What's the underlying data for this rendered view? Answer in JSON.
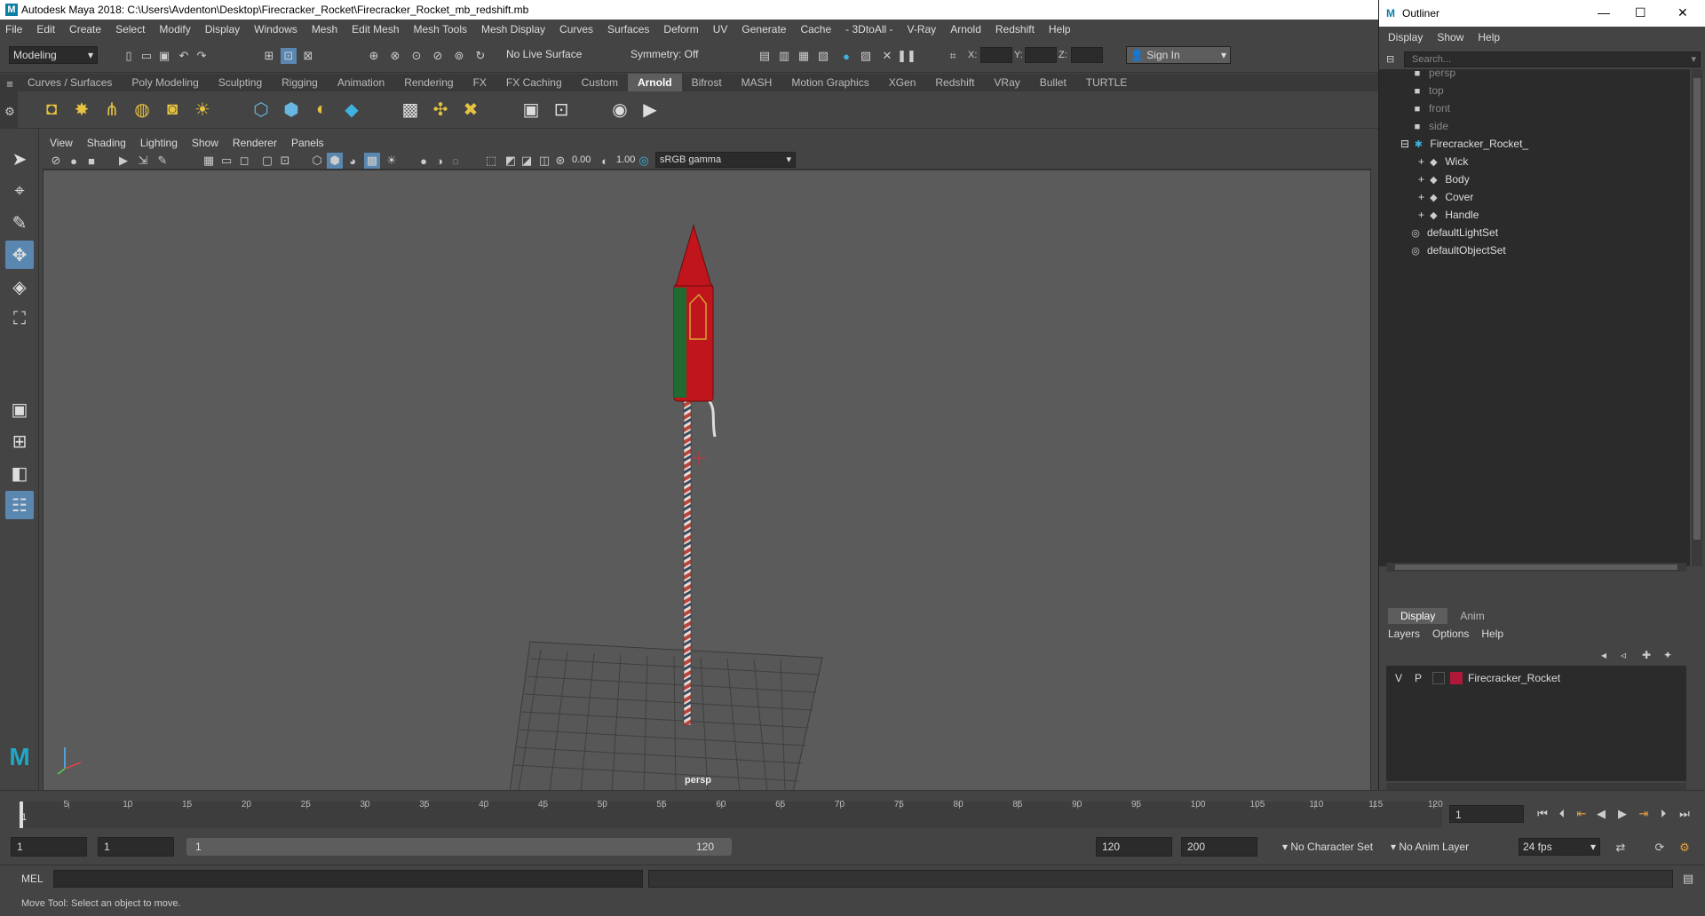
{
  "window": {
    "title": "Autodesk Maya 2018: C:\\Users\\Avdenton\\Desktop\\Firecracker_Rocket\\Firecracker_Rocket_mb_redshift.mb"
  },
  "menubar": [
    "File",
    "Edit",
    "Create",
    "Select",
    "Modify",
    "Display",
    "Windows",
    "Mesh",
    "Edit Mesh",
    "Mesh Tools",
    "Mesh Display",
    "Curves",
    "Surfaces",
    "Deform",
    "UV",
    "Generate",
    "Cache",
    "- 3DtoAll -",
    "V-Ray",
    "Arnold",
    "Redshift",
    "Help"
  ],
  "statusline": {
    "mode": "Modeling",
    "live_surface": "No Live Surface",
    "symmetry": "Symmetry: Off",
    "x_label": "X:",
    "y_label": "Y:",
    "z_label": "Z:",
    "sign_in": "Sign In"
  },
  "shelf_tabs": [
    "Curves / Surfaces",
    "Poly Modeling",
    "Sculpting",
    "Rigging",
    "Animation",
    "Rendering",
    "FX",
    "FX Caching",
    "Custom",
    "Arnold",
    "Bifrost",
    "MASH",
    "Motion Graphics",
    "XGen",
    "Redshift",
    "VRay",
    "Bullet",
    "TURTLE"
  ],
  "shelf_active": "Arnold",
  "viewport": {
    "menu": [
      "View",
      "Shading",
      "Lighting",
      "Show",
      "Renderer",
      "Panels"
    ],
    "exposure": "0.00",
    "gamma": "1.00",
    "color_space": "sRGB gamma",
    "camera_label": "persp"
  },
  "outliner": {
    "title": "Outliner",
    "menu": [
      "Display",
      "Show",
      "Help"
    ],
    "search_placeholder": "Search...",
    "items": [
      {
        "label": "persp",
        "dim": true,
        "icon": "camera-icon"
      },
      {
        "label": "top",
        "dim": true,
        "icon": "camera-icon"
      },
      {
        "label": "front",
        "dim": true,
        "icon": "camera-icon"
      },
      {
        "label": "side",
        "dim": true,
        "icon": "camera-icon"
      },
      {
        "label": "Firecracker_Rocket_",
        "dim": false,
        "icon": "group-icon"
      },
      {
        "label": "Wick",
        "dim": false,
        "icon": "mesh-icon"
      },
      {
        "label": "Body",
        "dim": false,
        "icon": "mesh-icon"
      },
      {
        "label": "Cover",
        "dim": false,
        "icon": "mesh-icon"
      },
      {
        "label": "Handle",
        "dim": false,
        "icon": "mesh-icon"
      },
      {
        "label": "defaultLightSet",
        "dim": false,
        "icon": "set-icon"
      },
      {
        "label": "defaultObjectSet",
        "dim": false,
        "icon": "set-icon"
      }
    ]
  },
  "layers": {
    "tabs": [
      "Display",
      "Anim"
    ],
    "menu": [
      "Layers",
      "Options",
      "Help"
    ],
    "rows": [
      {
        "v": "V",
        "p": "P",
        "name": "Firecracker_Rocket",
        "color": "#b0183a"
      }
    ]
  },
  "timeslider": {
    "ticks": [
      "5",
      "10",
      "15",
      "20",
      "25",
      "30",
      "35",
      "40",
      "45",
      "50",
      "55",
      "60",
      "65",
      "70",
      "75",
      "80",
      "85",
      "90",
      "95",
      "100",
      "105",
      "110",
      "115",
      "120"
    ],
    "current_frame_label": "1",
    "current_frame_field": "1"
  },
  "range": {
    "start": "1",
    "playback_start": "1",
    "range_start_label": "1",
    "range_end_label": "120",
    "playback_end": "120",
    "end": "200",
    "character_set": "No Character Set",
    "anim_layer": "No Anim Layer",
    "fps": "24 fps"
  },
  "cmdline": {
    "label": "MEL"
  },
  "helpline": {
    "text": "Move Tool: Select an object to move."
  },
  "colors": {
    "accent": "#5a87b0",
    "layer": "#b0183a",
    "rocket_red": "#c0151c",
    "rocket_green": "#1f6b32"
  }
}
